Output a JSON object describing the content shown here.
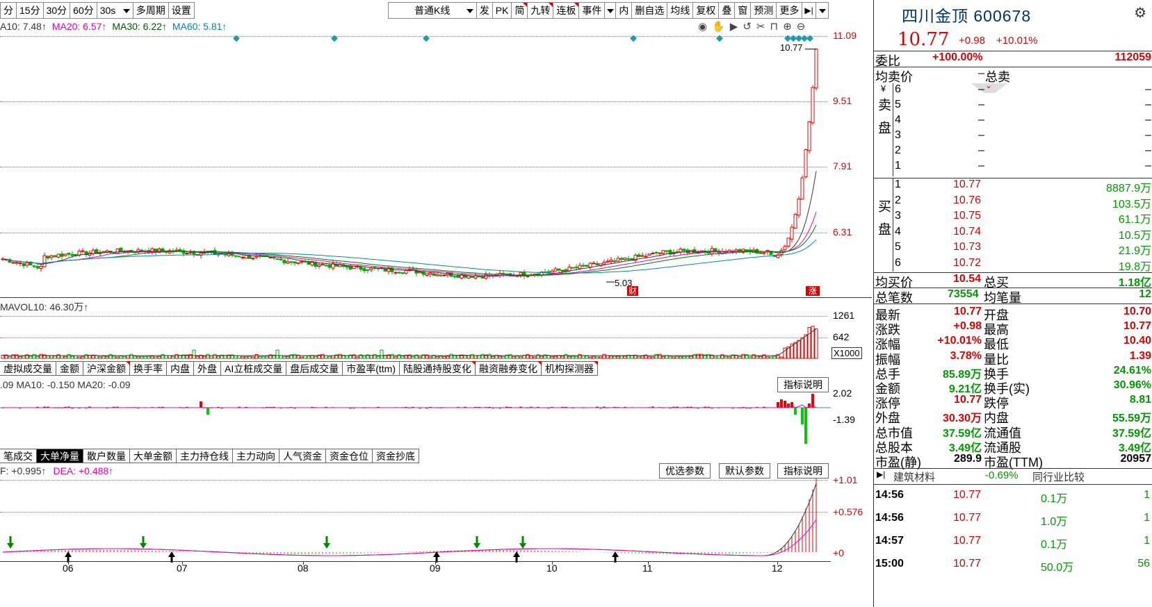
{
  "toolbar": {
    "periods": [
      "分",
      "15分",
      "30分",
      "60分",
      "30s"
    ],
    "multi_period": "多周期",
    "settings": "设置",
    "kline_type": "普通K线",
    "tools": [
      "发",
      "PK",
      "简",
      "九转",
      "连板",
      "事件",
      "内",
      "删自选",
      "均线",
      "复权",
      "叠",
      "窗",
      "预测",
      "更多"
    ]
  },
  "ma_legend": {
    "ma10": "A10: 7.48↑",
    "ma20": "MA20: 6.57↑",
    "ma30": "MA30: 6.22↑",
    "ma60": "MA60: 5.81↑"
  },
  "price_axis": [
    "11.09",
    "9.51",
    "7.91",
    "6.31"
  ],
  "last_price_tag": "10.77",
  "low_tag": "5.03",
  "badge_cai": "财",
  "badge_zhang": "涨",
  "volume": {
    "legend": "MAVOL10: 46.30万↑",
    "axis": [
      "1261",
      "642"
    ],
    "unit": "X1000"
  },
  "tabs1": [
    "虚拟成交量",
    "金额",
    "沪深金额",
    "换手率",
    "内盘",
    "外盘",
    "AI立桩成交量",
    "盘后成交量",
    "市盈率(ttm)",
    "陆股通持股变化",
    "融资融券变化",
    "机构探测器"
  ],
  "tabs1_red": [
    2,
    9,
    10,
    11
  ],
  "ind1": {
    "legend": ".09  MA10: -0.150  MA20: -0.09",
    "axis": [
      "2.02",
      "-1.39"
    ],
    "btn": "指标说明"
  },
  "tabs2": [
    "笔成交",
    "大单净量",
    "散户数量",
    "大单金额",
    "主力持仓线",
    "主力动向",
    "人气资金",
    "资金仓位",
    "资金抄底"
  ],
  "tabs2_active": 1,
  "ind2": {
    "legend_dif": "F: +0.995↑",
    "legend_dea": "DEA: +0.488↑",
    "axis": [
      "+1.01",
      "+0.576",
      "+0"
    ],
    "btn_opt": "优选参数",
    "btn_default": "默认参数",
    "btn_explain": "指标说明"
  },
  "x_axis": [
    "06",
    "07",
    "08",
    "09",
    "10",
    "11",
    "12"
  ],
  "chart_data": {
    "type": "candlestick",
    "title": "",
    "ylim": [
      5.03,
      11.09
    ],
    "x_categories": [
      "06",
      "07",
      "08",
      "09",
      "10",
      "11",
      "12"
    ],
    "last_close": 10.77,
    "period_low": 5.03,
    "ma_latest": {
      "MA10": 7.48,
      "MA20": 6.57,
      "MA30": 6.22,
      "MA60": 5.81
    },
    "volume_axis": [
      1261,
      642
    ],
    "macd_latest": {
      "DIF": 0.995,
      "DEA": 0.488
    }
  },
  "quote": {
    "title": "四川金顶 600678",
    "price": "10.77",
    "change": "+0.98",
    "change_pct": "+10.01%",
    "weibi_label": "委比",
    "weibi": "+100.00%",
    "weicha": "112059",
    "avg_sell_label": "均卖价",
    "avg_sell": "–",
    "total_sell_label": "总卖",
    "sell_side": "卖盘",
    "yen": "¥",
    "sell": [
      {
        "lvl": "6",
        "p": "–",
        "v": "–"
      },
      {
        "lvl": "5",
        "p": "–",
        "v": "–"
      },
      {
        "lvl": "4",
        "p": "–",
        "v": "–"
      },
      {
        "lvl": "3",
        "p": "–",
        "v": "–"
      },
      {
        "lvl": "2",
        "p": "–",
        "v": "–"
      },
      {
        "lvl": "1",
        "p": "–",
        "v": "–"
      }
    ],
    "buy_side": "买盘",
    "buy": [
      {
        "lvl": "1",
        "p": "10.77",
        "v": "8887.9万"
      },
      {
        "lvl": "2",
        "p": "10.76",
        "v": "103.5万"
      },
      {
        "lvl": "3",
        "p": "10.75",
        "v": "61.1万"
      },
      {
        "lvl": "4",
        "p": "10.74",
        "v": "10.5万"
      },
      {
        "lvl": "5",
        "p": "10.73",
        "v": "21.9万"
      },
      {
        "lvl": "6",
        "p": "10.72",
        "v": "19.8万"
      }
    ],
    "avg_buy_label": "均买价",
    "avg_buy": "10.54",
    "total_buy_label": "总买",
    "total_buy": "1.18亿",
    "trades_label": "总笔数",
    "trades": "73554",
    "avg_vol_label": "均笔量",
    "avg_vol": "12",
    "stats": [
      {
        "l1": "最新",
        "v1": "10.77",
        "c1": "red",
        "l2": "开盘",
        "v2": "10.70",
        "c2": "red"
      },
      {
        "l1": "涨跌",
        "v1": "+0.98",
        "c1": "red",
        "l2": "最高",
        "v2": "10.77",
        "c2": "red"
      },
      {
        "l1": "涨幅",
        "v1": "+10.01%",
        "c1": "red",
        "l2": "最低",
        "v2": "10.40",
        "c2": "red"
      },
      {
        "l1": "振幅",
        "v1": "3.78%",
        "c1": "red",
        "l2": "量比",
        "v2": "1.39",
        "c2": "red"
      },
      {
        "l1": "总手",
        "v1": "85.89万",
        "c1": "green",
        "l2": "换手",
        "v2": "24.61%",
        "c2": "green"
      },
      {
        "l1": "金额",
        "v1": "9.21亿",
        "c1": "green",
        "l2": "换手(实)",
        "v2": "30.96%",
        "c2": "green"
      },
      {
        "l1": "涨停",
        "v1": "10.77",
        "c1": "red",
        "l2": "跌停",
        "v2": "8.81",
        "c2": "green"
      },
      {
        "l1": "外盘",
        "v1": "30.30万",
        "c1": "red",
        "l2": "内盘",
        "v2": "55.59万",
        "c2": "green"
      },
      {
        "l1": "总市值",
        "v1": "37.59亿",
        "c1": "green",
        "l2": "流通值",
        "v2": "37.59亿",
        "c2": "green"
      },
      {
        "l1": "总股本",
        "v1": "3.49亿",
        "c1": "green",
        "l2": "流通股",
        "v2": "3.49亿",
        "c2": "green"
      },
      {
        "l1": "市盈(静)",
        "v1": "289.9",
        "c1": "dark",
        "l2": "市盈(TTM)",
        "v2": "20957",
        "c2": "dark"
      }
    ],
    "industry": "建筑材料",
    "industry_chg": "-0.69%",
    "industry_btn": "同行业比较",
    "ticks": [
      {
        "t": "14:56",
        "p": "10.77",
        "v": "0.1万",
        "n": "1"
      },
      {
        "t": "14:56",
        "p": "10.77",
        "v": "1.0万",
        "n": "1"
      },
      {
        "t": "14:57",
        "p": "10.77",
        "v": "0.1万",
        "n": "1"
      },
      {
        "t": "15:00",
        "p": "10.77",
        "v": "50.0万",
        "n": "56"
      }
    ]
  }
}
